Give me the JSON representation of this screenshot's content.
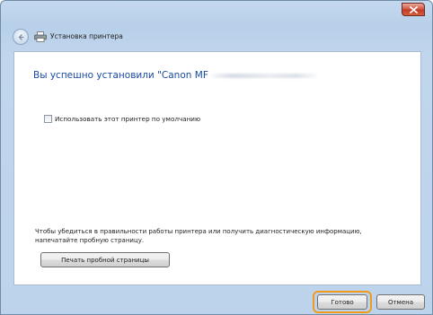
{
  "window": {
    "title": "Установка принтера",
    "close_icon": "close-icon",
    "back_icon": "back-arrow-icon",
    "printer_icon": "printer-icon"
  },
  "main": {
    "heading": "Вы успешно установили \"Canon MF",
    "default_printer_checkbox": {
      "label": "Использовать этот принтер по умолчанию",
      "checked": false
    },
    "info_line1": "Чтобы убедиться в правильности работы принтера или получить диагностическую информацию,",
    "info_line2": "напечатайте пробную страницу.",
    "test_page_button": "Печать пробной страницы"
  },
  "footer": {
    "ok_button": "Готово",
    "cancel_button": "Отмена",
    "highlight_color": "#f39a1c"
  }
}
